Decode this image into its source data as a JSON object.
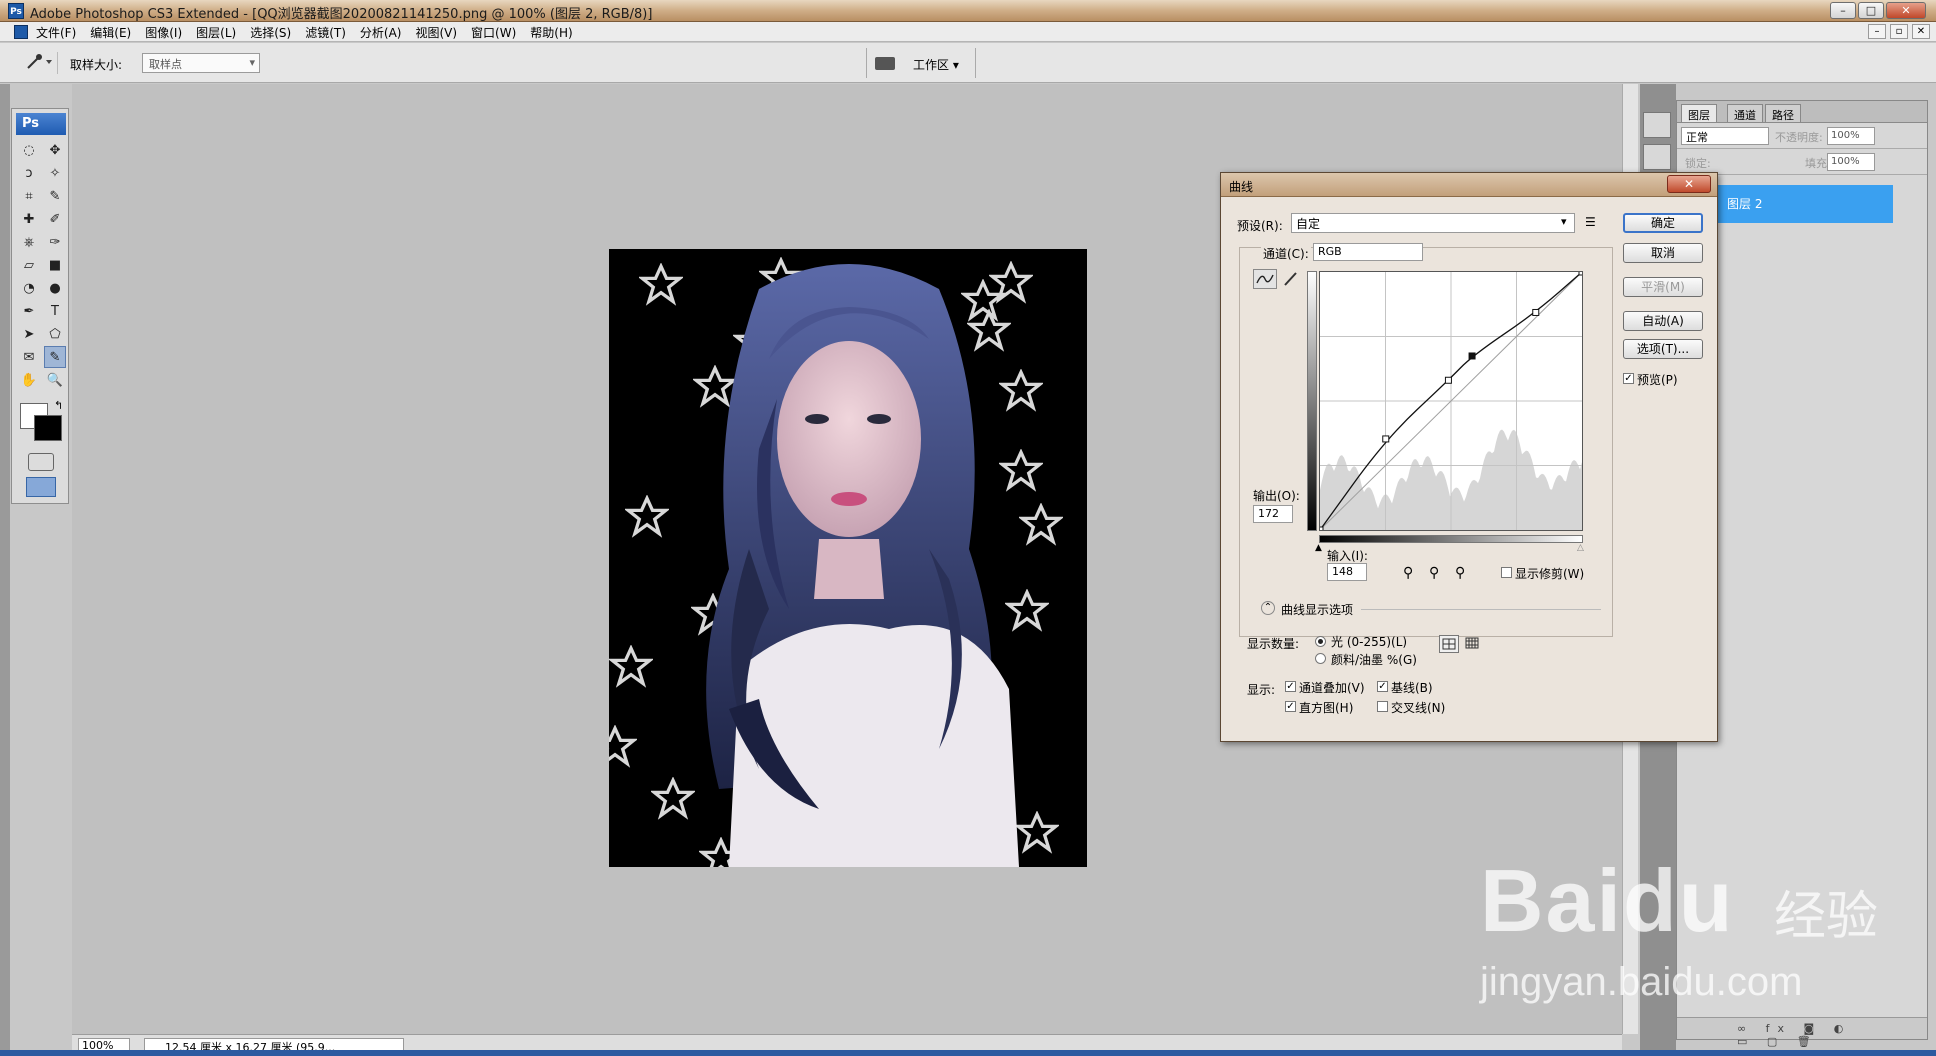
{
  "window": {
    "title": "Adobe Photoshop CS3 Extended - [QQ浏览器截图20200821141250.png @ 100% (图层 2, RGB/8)]",
    "app_icon": "Ps",
    "controls": [
      "–",
      "□",
      "✕"
    ]
  },
  "menubar": {
    "items": [
      "文件(F)",
      "编辑(E)",
      "图像(I)",
      "图层(L)",
      "选择(S)",
      "滤镜(T)",
      "分析(A)",
      "视图(V)",
      "窗口(W)",
      "帮助(H)"
    ],
    "mdi_controls": [
      "–",
      "▫",
      "✕"
    ]
  },
  "options": {
    "sample_size_label": "取样大小:",
    "sample_size_value": "取样点",
    "workspace_label": "工作区 ▾"
  },
  "toolbox": {
    "logo": "Ps",
    "tools": [
      "marquee-icon",
      "move-icon",
      "lasso-icon",
      "magic-wand-icon",
      "crop-icon",
      "slice-icon",
      "healing-icon",
      "brush-icon",
      "stamp-icon",
      "history-brush-icon",
      "eraser-icon",
      "gradient-icon",
      "blur-icon",
      "dodge-icon",
      "pen-icon",
      "type-icon",
      "path-select-icon",
      "shape-icon",
      "notes-icon",
      "eyedropper-icon",
      "hand-icon",
      "zoom-icon"
    ],
    "tool_glyphs": [
      "◌",
      "✥",
      "ↄ",
      "✧",
      "⌗",
      "✎",
      "✚",
      "✐",
      "⎈",
      "✑",
      "▱",
      "■",
      "◔",
      "●",
      "✒",
      "T",
      "➤",
      "⬠",
      "✉",
      "✎",
      "✋",
      "🔍"
    ],
    "active_tool_index": 19,
    "swap_glyph": "↰"
  },
  "statusbar": {
    "zoom": "100%",
    "doc_info": "12.54 厘米 x 16.27 厘米 (95.9..."
  },
  "layers_panel": {
    "tabs": [
      "图层",
      "通道",
      "路径"
    ],
    "blend_mode": "正常",
    "opacity_label": "不透明度:",
    "opacity_value": "100%",
    "lock_label": "锁定:",
    "fill_label": "填充:",
    "fill_value": "100%",
    "layer_name": "图层 2",
    "bottom_icons": "∞ fx ◙ ◐ ▭ ▢ 🗑"
  },
  "curves_dialog": {
    "title": "曲线",
    "close": "✕",
    "preset_label": "预设(R):",
    "preset_value": "自定",
    "channel_label": "通道(C):",
    "channel_value": "RGB",
    "output_label": "输出(O):",
    "output_value": "172",
    "input_label": "输入(I):",
    "input_value": "148",
    "show_clipping": "显示修剪(W)",
    "display_options": "曲线显示选项",
    "show_amount_label": "显示数量:",
    "light_option": "光 (0-255)(L)",
    "pigment_option": "颜料/油墨 %(G)",
    "show_label": "显示:",
    "channel_overlays": "通道叠加(V)",
    "baseline": "基线(B)",
    "histogram": "直方图(H)",
    "intersection": "交叉线(N)",
    "buttons": {
      "ok": "确定",
      "cancel": "取消",
      "smooth": "平滑(M)",
      "auto": "自动(A)",
      "options": "选项(T)..."
    },
    "preview": "预览(P)",
    "curve_points": [
      [
        0,
        0
      ],
      [
        64,
        90
      ],
      [
        125,
        148
      ],
      [
        148,
        172
      ],
      [
        210,
        215
      ],
      [
        255,
        255
      ]
    ]
  },
  "watermark": {
    "brand": "Baidu",
    "suffix": "经验",
    "url": "jingyan.baidu.com"
  }
}
